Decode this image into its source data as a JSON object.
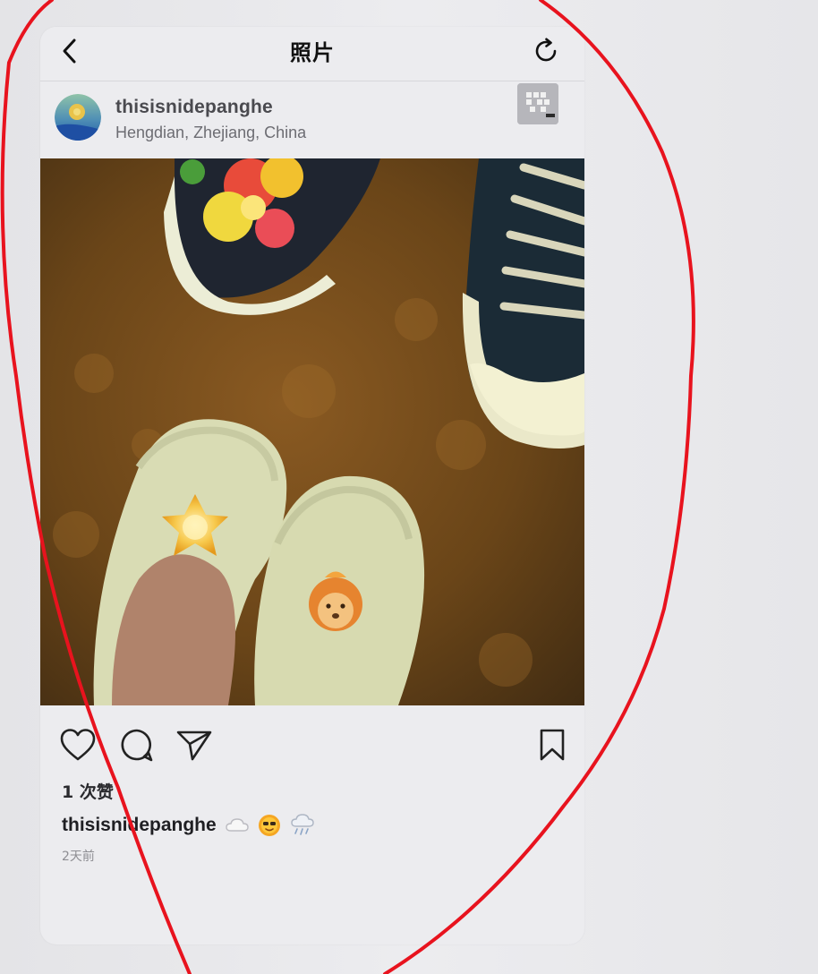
{
  "nav": {
    "title": "照片",
    "back_icon": "chevron-left-icon",
    "refresh_icon": "refresh-icon"
  },
  "post": {
    "username": "thisisnidepanghe",
    "location": "Hengdian, Zhejiang, China",
    "likes_text": "1 次赞",
    "caption_username": "thisisnidepanghe",
    "caption_emojis": [
      "cloud-emoji",
      "sun-face-emoji",
      "rain-cloud-emoji"
    ],
    "time_ago": "2天前"
  },
  "actions": {
    "like_icon": "heart-icon",
    "comment_icon": "comment-icon",
    "share_icon": "send-icon",
    "save_icon": "bookmark-icon"
  },
  "colors": {
    "background": "#e9e9ec",
    "text_primary": "#1f1f23",
    "text_secondary": "#6d6d73",
    "marker": "#e8131e"
  }
}
